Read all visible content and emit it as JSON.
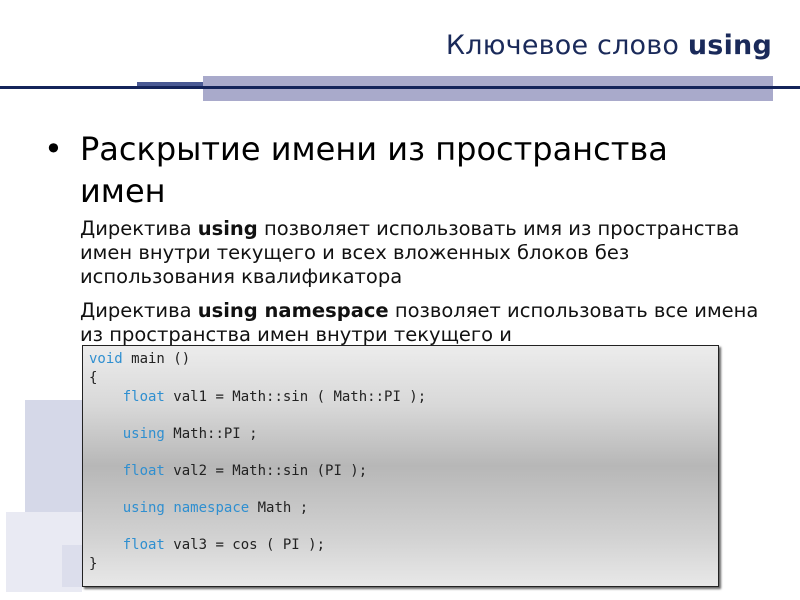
{
  "slide": {
    "title_prefix": "Ключевое слово ",
    "title_keyword": "using",
    "bullet": {
      "glyph": "•",
      "text": "Раскрытие имени из пространства имен"
    },
    "paragraphs": [
      {
        "before": "Директива ",
        "bold": "using",
        "after": " позволяет использовать имя из пространства имен внутри текущего и всех вложенных блоков без использования квалификатора"
      },
      {
        "before": "Директива ",
        "bold": "using namespace",
        "after": " позволяет использовать все имена из пространства имен внутри текущего и"
      }
    ],
    "code": {
      "l1_kw": "void",
      "l1_rest": " main ()",
      "l2": "{",
      "l3_indent": "    ",
      "l3_kw": "float",
      "l3_rest": " val1 = Math::sin ( Math::PI );",
      "l4_indent": "    ",
      "l4_kw": "using",
      "l4_rest": " Math::PI ;",
      "l5_indent": "    ",
      "l5_kw": "float",
      "l5_rest": " val2 = Math::sin (PI );",
      "l6_indent": "    ",
      "l6_kw1": "using",
      "l6_sp": " ",
      "l6_kw2": "namespace",
      "l6_rest": " Math ;",
      "l7_indent": "    ",
      "l7_kw": "float",
      "l7_rest": " val3 = cos ( PI );",
      "l8": "}"
    }
  }
}
